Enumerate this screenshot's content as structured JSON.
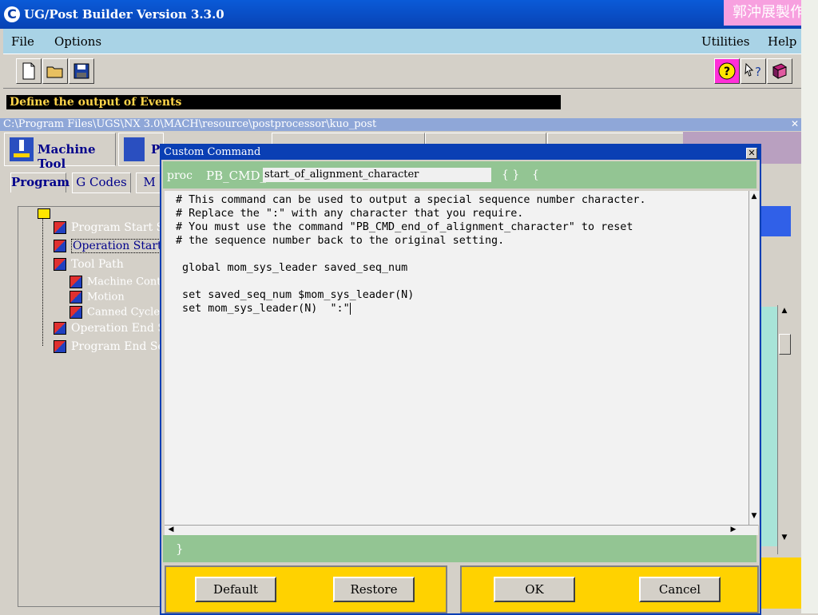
{
  "app": {
    "title": "UG/Post Builder Version 3.3.0",
    "logo": "C",
    "watermark": "郭沖展製作"
  },
  "menubar": {
    "file": "File",
    "options": "Options",
    "utilities": "Utilities",
    "help": "Help"
  },
  "toolbar": {
    "new_icon": "new-file-icon",
    "open_icon": "open-folder-icon",
    "save_icon": "save-disk-icon",
    "help_icon": "help-question-icon",
    "context_help_icon": "context-help-icon",
    "manual_icon": "manual-book-icon"
  },
  "status": {
    "text": "Define the output of Events"
  },
  "path": {
    "text": "C:\\Program Files\\UGS\\NX 3.0\\MACH\\resource\\postprocessor\\kuo_post"
  },
  "main_tabs": {
    "machine_tool": "Machine Tool",
    "program_partial": "P"
  },
  "sub_tabs": {
    "program": "Program",
    "g_codes": "G Codes",
    "m_partial": "M"
  },
  "tree": {
    "items": [
      {
        "label": "Program Start Se"
      },
      {
        "label": "Operation Start S"
      },
      {
        "label": "Tool Path"
      },
      {
        "label": "Machine Contro"
      },
      {
        "label": "Motion"
      },
      {
        "label": "Canned Cycles"
      },
      {
        "label": "Operation End S"
      },
      {
        "label": "Program End Se"
      }
    ]
  },
  "dialog": {
    "title": "Custom Command",
    "proc_keyword": "proc",
    "proc_prefix": "PB_CMD_",
    "proc_name": "start_of_alignment_character",
    "braces": "{ }",
    "open_brace": "{",
    "close_brace": "}",
    "code_lines": [
      "# This command can be used to output a special sequence number character.",
      "# Replace the \":\" with any character that you require.",
      "# You must use the command \"PB_CMD_end_of_alignment_character\" to reset",
      "# the sequence number back to the original setting.",
      "",
      " global mom_sys_leader saved_seq_num",
      "",
      " set saved_seq_num $mom_sys_leader(N)",
      " set mom_sys_leader(N)  \":\""
    ],
    "buttons": {
      "default": "Default",
      "restore": "Restore",
      "ok": "OK",
      "cancel": "Cancel"
    }
  }
}
